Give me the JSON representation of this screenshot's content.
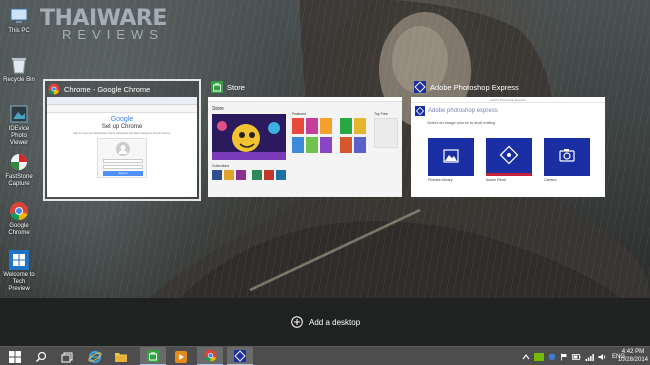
{
  "watermark": {
    "line1": "THAIWARE",
    "line2": "REVIEWS"
  },
  "desktop_icons": [
    {
      "label": "This PC",
      "icon": "computer-icon"
    },
    {
      "label": "Recycle Bin",
      "icon": "recycle-bin-icon"
    },
    {
      "label": "IDEvice Photo Viewer",
      "icon": "photo-viewer-icon"
    },
    {
      "label": "FastStone Capture",
      "icon": "faststone-capture-icon"
    },
    {
      "label": "Google Chrome",
      "icon": "chrome-icon"
    },
    {
      "label": "Welcome to Tech Preview",
      "icon": "windows-logo-icon"
    }
  ],
  "windows": {
    "chrome": {
      "title": "Chrome - Google Chrome",
      "logo": "Google",
      "heading": "Set up Chrome",
      "subtext": "Sign in to get your bookmarks, history, passwords and other settings on all your devices.",
      "button": "Sign in"
    },
    "store": {
      "title": "Store",
      "header": "Store",
      "section_featured": "Featured",
      "section_top": "Top Free",
      "section_collections": "Collections"
    },
    "photoshop": {
      "title": "Adobe Photoshop Express",
      "window_caption": "Adobe Photoshop Express",
      "brand": "Adobe photoshop express",
      "prompt": "Select an image source to start editing",
      "tiles": [
        "Pictures Library",
        "Adobe Revel",
        "Camera"
      ]
    }
  },
  "add_desktop": {
    "label": "Add a desktop"
  },
  "taskbar": {
    "apps": [
      "start",
      "search",
      "task-view",
      "internet-explorer",
      "file-explorer",
      "store",
      "windows-media-player",
      "chrome",
      "photoshop-express"
    ],
    "tray": {
      "language": "ENG"
    },
    "clock": {
      "time": "4:42 PM",
      "date": "10/28/2014"
    }
  },
  "colors": {
    "accent_green": "#33a141",
    "adobe_blue": "#1a2fa3",
    "taskbar": "#4d4d4d",
    "panel": "#202222"
  }
}
